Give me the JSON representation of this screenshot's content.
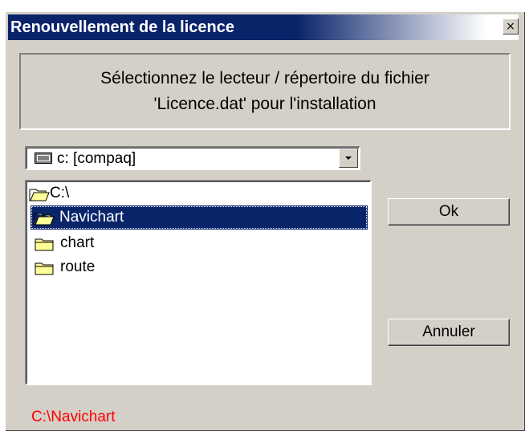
{
  "window": {
    "title": "Renouvellement de la licence",
    "close_glyph": "×"
  },
  "message": {
    "line1": "Sélectionnez le lecteur / répertoire du fichier",
    "line2": "'Licence.dat' pour l'installation"
  },
  "drive": {
    "selected": "c: [compaq]",
    "icon": "drive-icon"
  },
  "tree": {
    "items": [
      {
        "label": "C:\\",
        "icon": "folder-open-icon",
        "selected": false
      },
      {
        "label": "Navichart",
        "icon": "folder-open-icon",
        "selected": true
      },
      {
        "label": "chart",
        "icon": "folder-closed-icon",
        "selected": false
      },
      {
        "label": "route",
        "icon": "folder-closed-icon",
        "selected": false
      }
    ]
  },
  "buttons": {
    "ok": "Ok",
    "cancel": "Annuler"
  },
  "current_path": "C:\\Navichart",
  "colors": {
    "title_bar": "#0a246a",
    "selection": "#0a246a",
    "path_text": "#ff0000",
    "dialog_face": "#d4d0c8",
    "folder_yellow": "#ffff99"
  }
}
